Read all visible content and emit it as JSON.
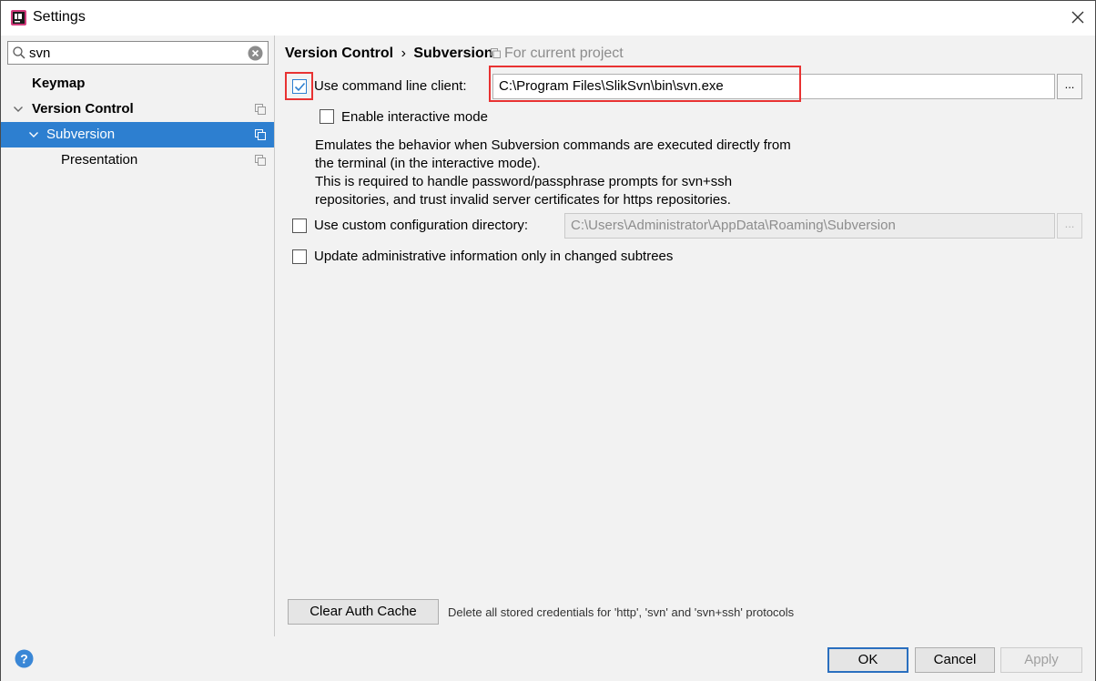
{
  "window": {
    "title": "Settings"
  },
  "sidebar": {
    "search": {
      "value": "svn",
      "placeholder": ""
    },
    "items": [
      {
        "label": "Keymap",
        "level": 0,
        "bold": true
      },
      {
        "label": "Version Control",
        "level": 0,
        "bold": true,
        "expanded": true
      },
      {
        "label": "Subversion",
        "level": 1,
        "bold": false,
        "expanded": true,
        "selected": true
      },
      {
        "label": "Presentation",
        "level": 2,
        "bold": false
      }
    ]
  },
  "main": {
    "breadcrumb": {
      "parent": "Version Control",
      "separator": "›",
      "current": "Subversion"
    },
    "scope": "For current project",
    "use_cmd_client": {
      "label": "Use command line client:",
      "checked": true,
      "path": "C:\\Program Files\\SlikSvn\\bin\\svn.exe",
      "browse_label": "..."
    },
    "interactive_mode": {
      "label": "Enable interactive mode",
      "checked": false
    },
    "description": [
      "Emulates the behavior when Subversion commands are executed directly from",
      "the terminal (in the interactive mode).",
      "This is required to handle password/passphrase prompts for svn+ssh",
      "repositories, and trust invalid server certificates for https repositories."
    ],
    "custom_config": {
      "label": "Use custom configuration directory:",
      "checked": false,
      "path": "C:\\Users\\Administrator\\AppData\\Roaming\\Subversion",
      "browse_label": "..."
    },
    "update_admin": {
      "label": "Update administrative information only in changed subtrees",
      "checked": false
    },
    "clear_auth": {
      "button": "Clear Auth Cache",
      "hint": "Delete all stored credentials for 'http', 'svn' and 'svn+ssh' protocols"
    }
  },
  "footer": {
    "ok": "OK",
    "cancel": "Cancel",
    "apply": "Apply"
  },
  "colors": {
    "selection": "#2d7fd0",
    "highlight": "#e83232",
    "primary_border": "#2a6fbf"
  }
}
